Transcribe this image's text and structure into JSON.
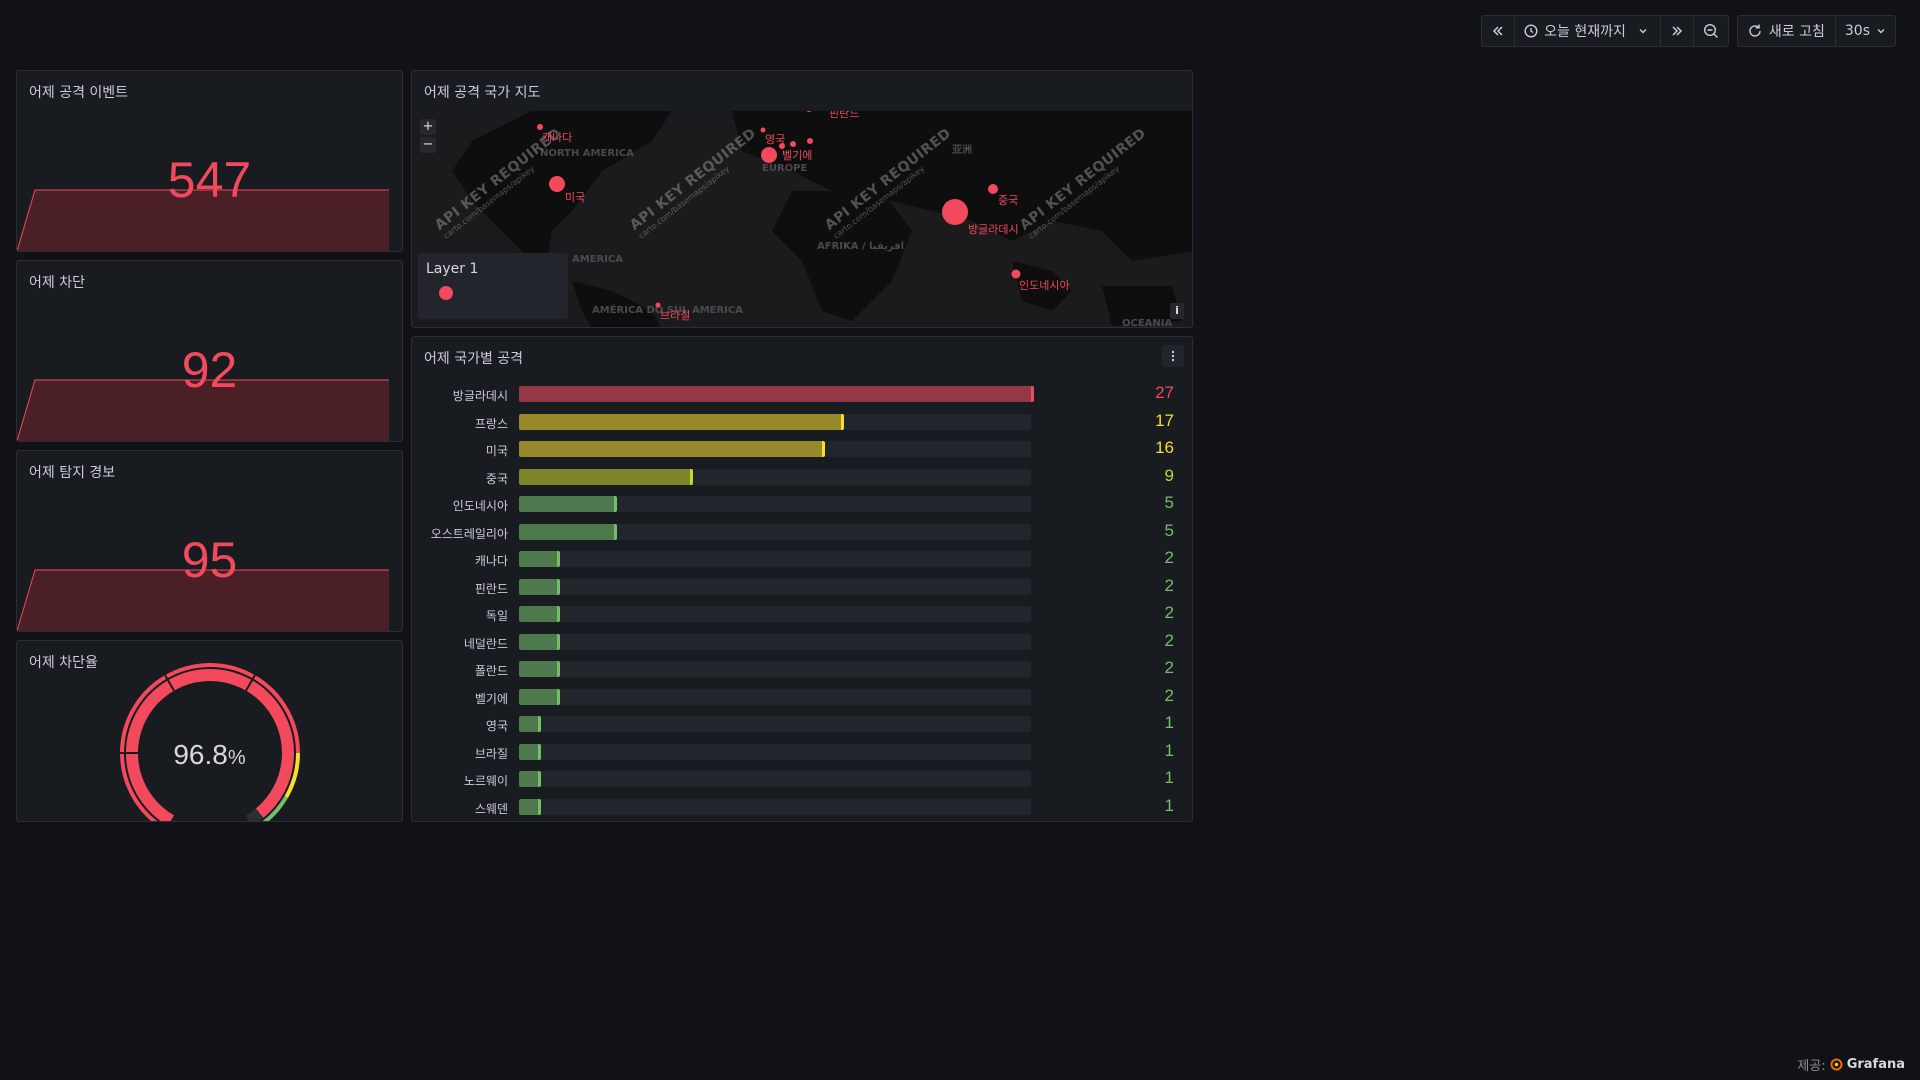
{
  "toolbar": {
    "time_range_label": "오늘 현재까지",
    "refresh_label": "새로 고침",
    "interval_label": "30s"
  },
  "panels": {
    "events": {
      "title": "어제 공격 이벤트",
      "value": "547"
    },
    "blocked": {
      "title": "어제 차단",
      "value": "92"
    },
    "alerts": {
      "title": "어제 탐지 경보",
      "value": "95"
    },
    "block_rate": {
      "title": "어제 차단율",
      "value": "96.8",
      "unit": "%",
      "percent": 96.8
    }
  },
  "map": {
    "title": "어제 공격 국가 지도",
    "watermark": "API KEY REQUIRED",
    "watermark_sub": "carto.com/basemaps/apikey",
    "legend_title": "Layer 1",
    "zoom_in": "+",
    "zoom_out": "−",
    "info": "i",
    "country_labels": [
      "캐나다",
      "미국",
      "영국",
      "벨기에",
      "핀란드",
      "중국",
      "방글라데시",
      "인도네시아",
      "브라질"
    ],
    "region_labels": [
      "NORTH AMERICA",
      "EUROPE",
      "AFRIKA / افريقيا",
      "AMERICA",
      "AMÉRICA DO SUL AMERICA",
      "OCEANIA",
      "亚洲"
    ]
  },
  "bar_panel": {
    "title": "어제 국가별 공격",
    "max": 27,
    "rows": [
      {
        "label": "방글라데시",
        "value": 27,
        "color": "#f2495c"
      },
      {
        "label": "프랑스",
        "value": 17,
        "color": "#fade2a"
      },
      {
        "label": "미국",
        "value": 16,
        "color": "#fade2a"
      },
      {
        "label": "중국",
        "value": 9,
        "color": "#c8d42a"
      },
      {
        "label": "인도네시아",
        "value": 5,
        "color": "#73bf69"
      },
      {
        "label": "오스트레일리아",
        "value": 5,
        "color": "#73bf69"
      },
      {
        "label": "캐나다",
        "value": 2,
        "color": "#73bf69"
      },
      {
        "label": "핀란드",
        "value": 2,
        "color": "#73bf69"
      },
      {
        "label": "독일",
        "value": 2,
        "color": "#73bf69"
      },
      {
        "label": "네덜란드",
        "value": 2,
        "color": "#73bf69"
      },
      {
        "label": "폴란드",
        "value": 2,
        "color": "#73bf69"
      },
      {
        "label": "벨기에",
        "value": 2,
        "color": "#73bf69"
      },
      {
        "label": "영국",
        "value": 1,
        "color": "#73bf69"
      },
      {
        "label": "브라질",
        "value": 1,
        "color": "#73bf69"
      },
      {
        "label": "노르웨이",
        "value": 1,
        "color": "#73bf69"
      },
      {
        "label": "스웨덴",
        "value": 1,
        "color": "#73bf69"
      }
    ]
  },
  "footer": {
    "prefix": "제공:",
    "brand": "Grafana"
  }
}
